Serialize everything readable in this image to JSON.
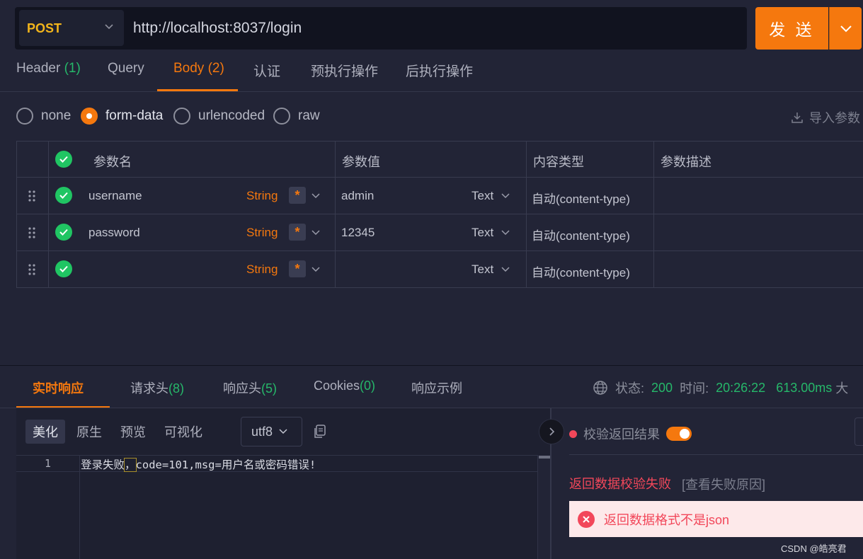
{
  "request": {
    "method": "POST",
    "url": "http://localhost:8037/login",
    "send_label": "发 送"
  },
  "req_tabs": [
    {
      "label": "Header",
      "count": "(1)"
    },
    {
      "label": "Query",
      "count": ""
    },
    {
      "label": "Body",
      "count": "(2)"
    },
    {
      "label": "认证",
      "count": ""
    },
    {
      "label": "预执行操作",
      "count": ""
    },
    {
      "label": "后执行操作",
      "count": ""
    }
  ],
  "active_req_tab": "Body",
  "body_modes": [
    "none",
    "form-data",
    "urlencoded",
    "raw"
  ],
  "selected_body_mode": "form-data",
  "import_label": "导入参数",
  "params": {
    "headers": [
      "参数名",
      "参数值",
      "内容类型",
      "参数描述"
    ],
    "rows": [
      {
        "name": "username",
        "type": "String",
        "required": "*",
        "value": "admin",
        "value_type": "Text",
        "content_type": "自动(content-type)",
        "desc": ""
      },
      {
        "name": "password",
        "type": "String",
        "required": "*",
        "value": "12345",
        "value_type": "Text",
        "content_type": "自动(content-type)",
        "desc": ""
      },
      {
        "name": "",
        "type": "String",
        "required": "*",
        "value": "",
        "value_type": "Text",
        "content_type": "自动(content-type)",
        "desc": ""
      }
    ]
  },
  "resp_tabs": [
    {
      "label": "实时响应",
      "count": ""
    },
    {
      "label": "请求头",
      "count": "(8)"
    },
    {
      "label": "响应头",
      "count": "(5)"
    },
    {
      "label": "Cookies",
      "count": "(0)"
    },
    {
      "label": "响应示例",
      "count": ""
    }
  ],
  "status": {
    "status_label": "状态:",
    "status_value": "200",
    "time_label": "时间:",
    "time_value": "20:26:22",
    "duration": "613.00ms",
    "size_label": "大"
  },
  "view_modes": [
    "美化",
    "原生",
    "预览",
    "可视化"
  ],
  "active_view_mode": "美化",
  "encoding": "utf8",
  "response_body": {
    "line_no": "1",
    "pre": "登录失败",
    "hl": "，",
    "post": "code=101,msg=用户名或密码错误!"
  },
  "verify": {
    "label": "校验返回结果",
    "enabled": true,
    "fail_title": "返回数据校验失败",
    "fail_link": "[查看失败原因]",
    "alert_text": "返回数据格式不是json"
  },
  "watermark": "CSDN @皓亮君",
  "colors": {
    "accent": "#f5780e",
    "success": "#20c563",
    "error": "#f2475a",
    "method": "#f2b51b"
  }
}
